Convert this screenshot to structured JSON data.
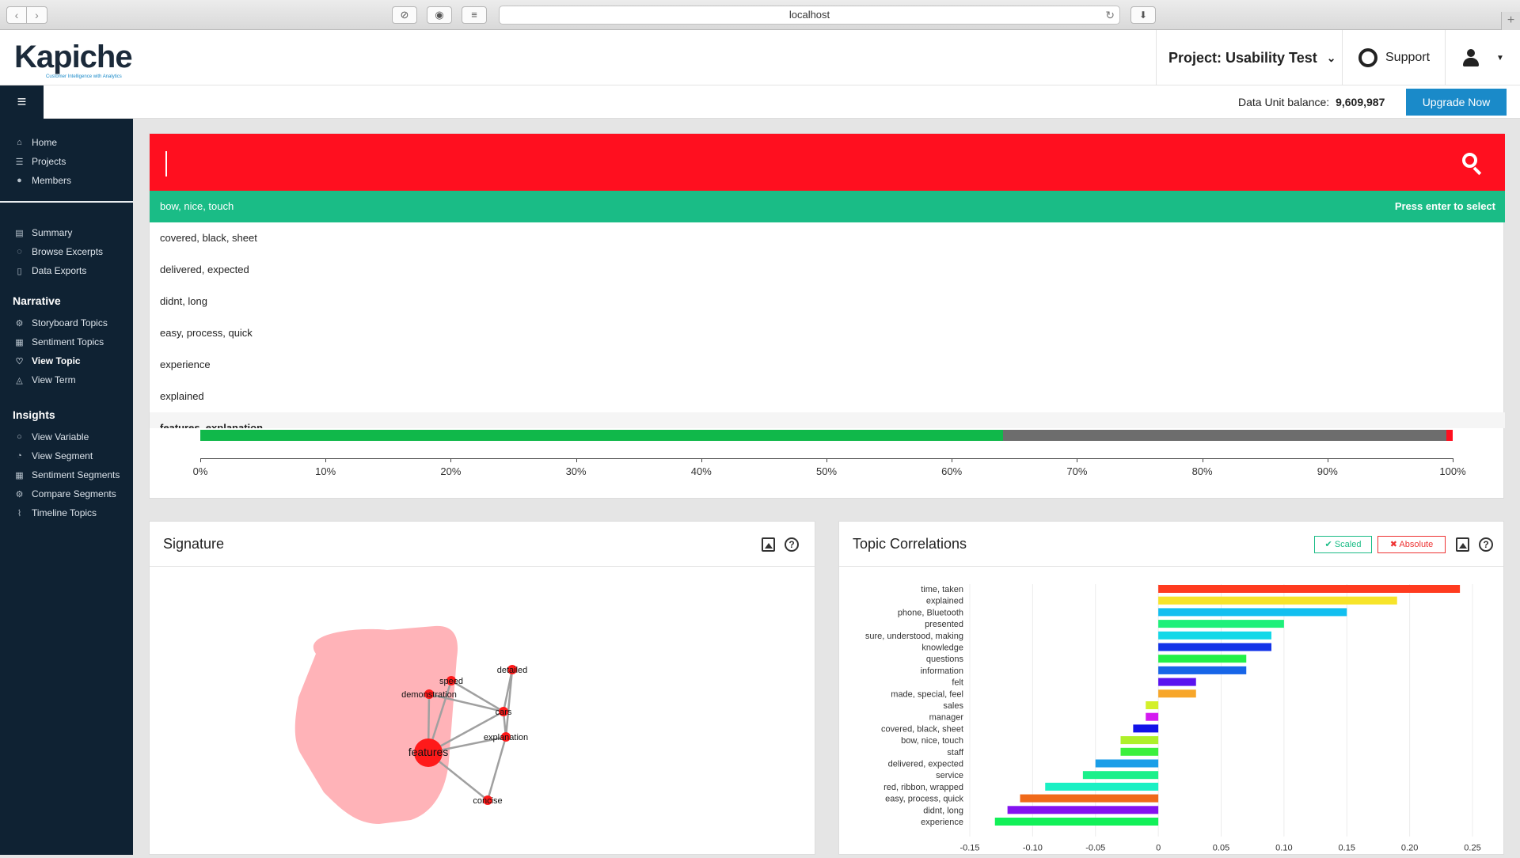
{
  "browser": {
    "url": "localhost"
  },
  "header": {
    "logo_text": "Kapiche",
    "logo_tagline": "Customer Intelligence with Analytics",
    "project_label": "Project: Usability Test",
    "support_label": "Support"
  },
  "subheader": {
    "balance_label": "Data Unit balance:",
    "balance_value": "9,609,987",
    "upgrade_label": "Upgrade Now"
  },
  "sidebar": {
    "main_items": [
      {
        "label": "Home",
        "icon": "home-icon"
      },
      {
        "label": "Projects",
        "icon": "list-icon"
      },
      {
        "label": "Members",
        "icon": "user-icon"
      }
    ],
    "project_items": [
      {
        "label": "Summary",
        "icon": "summary-icon"
      },
      {
        "label": "Browse Excerpts",
        "icon": "browse-icon"
      },
      {
        "label": "Data Exports",
        "icon": "file-icon"
      }
    ],
    "narrative_heading": "Narrative",
    "narrative_items": [
      {
        "label": "Storyboard Topics",
        "icon": "storyboard-icon"
      },
      {
        "label": "Sentiment Topics",
        "icon": "sentiment-icon"
      },
      {
        "label": "View Topic",
        "icon": "topic-icon",
        "active": true
      },
      {
        "label": "View Term",
        "icon": "term-icon"
      }
    ],
    "insights_heading": "Insights",
    "insights_items": [
      {
        "label": "View Variable",
        "icon": "variable-icon"
      },
      {
        "label": "View Segment",
        "icon": "segment-icon"
      },
      {
        "label": "Sentiment Segments",
        "icon": "sentiment-segments-icon"
      },
      {
        "label": "Compare Segments",
        "icon": "compare-icon"
      },
      {
        "label": "Timeline Topics",
        "icon": "timeline-icon"
      }
    ]
  },
  "search": {
    "value": "",
    "hint": "Press enter to select",
    "suggestions": [
      {
        "label": "bow, nice, touch",
        "highlight": true
      },
      {
        "label": "covered, black, sheet"
      },
      {
        "label": "delivered, expected"
      },
      {
        "label": "didnt, long"
      },
      {
        "label": "easy, process, quick"
      },
      {
        "label": "experience"
      },
      {
        "label": "explained"
      },
      {
        "label": "features, explanation",
        "partial": true
      }
    ],
    "progress": {
      "green_fraction": 0.641,
      "red_fraction": 0.005,
      "ticks": [
        "0%",
        "10%",
        "20%",
        "30%",
        "40%",
        "50%",
        "60%",
        "70%",
        "80%",
        "90%",
        "100%"
      ]
    }
  },
  "signature": {
    "title": "Signature",
    "nodes": [
      {
        "label": "detailed"
      },
      {
        "label": "speed"
      },
      {
        "label": "demonstration"
      },
      {
        "label": "cars"
      },
      {
        "label": "explanation"
      },
      {
        "label": "features"
      },
      {
        "label": "concise"
      }
    ],
    "colors": {
      "hull": "#ffb3b8",
      "node": "#ff1a1a",
      "edge": "#a0a0a0"
    }
  },
  "correlations": {
    "title": "Topic Correlations",
    "scaled_label": "Scaled",
    "absolute_label": "Absolute"
  },
  "chart_data": {
    "type": "bar",
    "orientation": "horizontal",
    "categories": [
      "time, taken",
      "explained",
      "phone, Bluetooth",
      "presented",
      "sure, understood, making",
      "knowledge",
      "questions",
      "information",
      "felt",
      "made, special, feel",
      "sales",
      "manager",
      "covered, black, sheet",
      "bow, nice, touch",
      "staff",
      "delivered, expected",
      "service",
      "red, ribbon, wrapped",
      "easy, process, quick",
      "didnt, long",
      "experience"
    ],
    "values": [
      0.24,
      0.19,
      0.15,
      0.1,
      0.09,
      0.09,
      0.07,
      0.07,
      0.03,
      0.03,
      -0.01,
      -0.01,
      -0.02,
      -0.03,
      -0.03,
      -0.05,
      -0.06,
      -0.09,
      -0.11,
      -0.12,
      -0.13
    ],
    "colors": [
      "#ff3b1f",
      "#f7e42a",
      "#12bff0",
      "#1ef07a",
      "#14d8e8",
      "#1233e8",
      "#22f047",
      "#1765e8",
      "#5a12f0",
      "#f7a62a",
      "#d4f02a",
      "#d41af0",
      "#1212e8",
      "#aef02a",
      "#3cf03c",
      "#1a9ee8",
      "#1af08a",
      "#1af0c4",
      "#f06a1a",
      "#8412f0",
      "#12f058"
    ],
    "xlim": [
      -0.15,
      0.25
    ],
    "xticks": [
      "-0.15",
      "-0.10",
      "-0.05",
      "0",
      "0.05",
      "0.10",
      "0.15",
      "0.20",
      "0.25"
    ],
    "grid": true
  }
}
